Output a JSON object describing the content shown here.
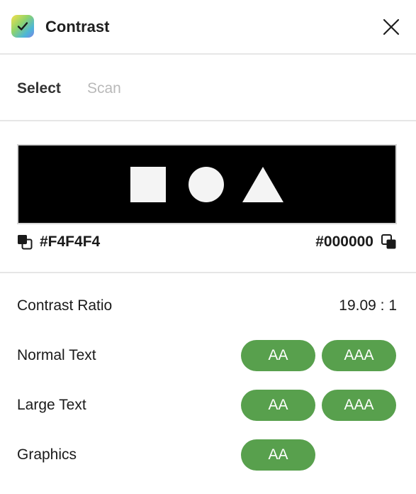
{
  "app": {
    "title": "Contrast",
    "icon": "checkmark-gradient-icon"
  },
  "tabs": [
    {
      "label": "Select",
      "active": true
    },
    {
      "label": "Scan",
      "active": false
    }
  ],
  "preview": {
    "foreground_hex": "#F4F4F4",
    "background_hex": "#000000",
    "shapes": [
      "square",
      "circle",
      "triangle"
    ]
  },
  "results": {
    "contrast_ratio_label": "Contrast Ratio",
    "contrast_ratio_value": "19.09 : 1",
    "rows": [
      {
        "label": "Normal Text",
        "badges": [
          "AA",
          "AAA"
        ]
      },
      {
        "label": "Large Text",
        "badges": [
          "AA",
          "AAA"
        ]
      },
      {
        "label": "Graphics",
        "badges": [
          "AA"
        ]
      }
    ]
  },
  "colors": {
    "pass_badge": "#58A04D",
    "divider": "#E6E6E6",
    "inactive_tab": "#B9B9B9"
  }
}
